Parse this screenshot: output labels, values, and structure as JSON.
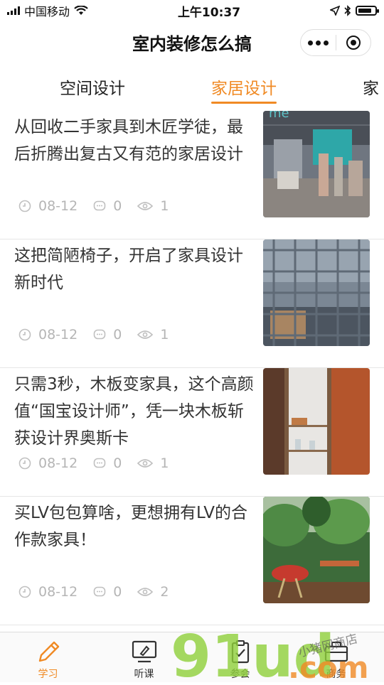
{
  "status_bar": {
    "carrier": "中国移动",
    "time": "上午10:37"
  },
  "nav": {
    "title": "室内装修怎么搞"
  },
  "tabs": [
    {
      "label": "空间设计",
      "active": false
    },
    {
      "label": "家居设计",
      "active": true
    },
    {
      "label": "家",
      "active": false
    }
  ],
  "articles": [
    {
      "title": "从回收二手家具到木匠学徒，最后折腾出复古又有范的家居设计",
      "date": "08-12",
      "comments": "0",
      "views": "1"
    },
    {
      "title": "这把简陋椅子，开启了家具设计新时代",
      "date": "08-12",
      "comments": "0",
      "views": "1"
    },
    {
      "title": "只需3秒，木板变家具，这个高颜值“国宝设计师”，凭一块木板斩获设计界奥斯卡",
      "date": "08-12",
      "comments": "0",
      "views": "1"
    },
    {
      "title": "买LV包包算啥，更想拥有LV的合作款家具！",
      "date": "08-12",
      "comments": "0",
      "views": "2"
    }
  ],
  "tabbar": [
    {
      "label": "学习",
      "icon": "pencil-icon",
      "active": true
    },
    {
      "label": "听课",
      "icon": "screen-icon",
      "active": false
    },
    {
      "label": "参会",
      "icon": "clipboard-icon",
      "active": false
    },
    {
      "label": "商务",
      "icon": "briefcase-icon",
      "active": false
    }
  ],
  "watermark": {
    "brand": "91ud",
    "suffix": ".com",
    "handwriting": "小猪网商店"
  },
  "colors": {
    "accent": "#f08a24",
    "meta": "#b5b5b5",
    "divider": "#e6e6e6"
  }
}
